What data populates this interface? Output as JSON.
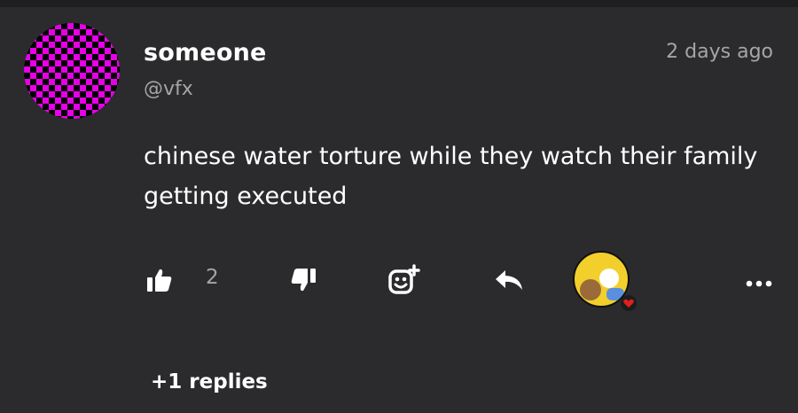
{
  "comment": {
    "author": "someone",
    "handle": "@vfx",
    "timestamp": "2 days ago",
    "text": "chinese water torture while they watch their family getting executed",
    "like_count": "2",
    "replies_label": "+1 replies"
  },
  "icons": {
    "like": "thumbs-up-icon",
    "dislike": "thumbs-down-icon",
    "react": "add-reaction-icon",
    "reply": "reply-arrow-icon",
    "more": "more-dots-icon",
    "reaction_heart": "heart-icon"
  },
  "colors": {
    "background": "#2b2b2d",
    "text_primary": "#ffffff",
    "text_secondary": "#a5a5a8",
    "avatar_pattern": "#e800e8",
    "heart": "#e0201e"
  }
}
